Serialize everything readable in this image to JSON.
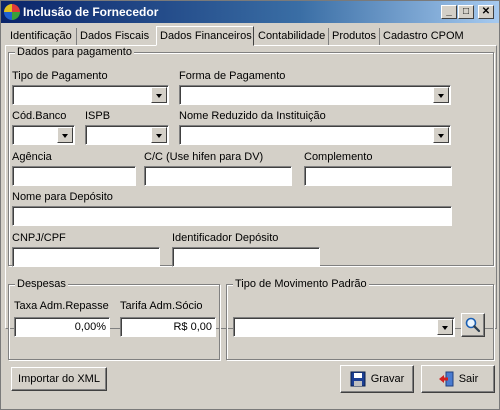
{
  "window": {
    "title": "Inclusão de Fornecedor",
    "minimize": "_",
    "maximize": "□",
    "close": "✕"
  },
  "tabs": [
    {
      "label": "Identificação"
    },
    {
      "label": "Dados Fiscais"
    },
    {
      "label": "Dados Financeiros",
      "active": true
    },
    {
      "label": "Contabilidade"
    },
    {
      "label": "Produtos"
    },
    {
      "label": "Cadastro CPOM"
    }
  ],
  "pagamento": {
    "legend": "Dados para pagamento",
    "tipo_pagamento": {
      "label": "Tipo de Pagamento",
      "value": ""
    },
    "forma_pagamento": {
      "label": "Forma de Pagamento",
      "value": ""
    },
    "cod_banco": {
      "label": "Cód.Banco",
      "value": ""
    },
    "ispb": {
      "label": "ISPB",
      "value": ""
    },
    "nome_reduzido": {
      "label": "Nome Reduzido da Instituição",
      "value": ""
    },
    "agencia": {
      "label": "Agência",
      "value": ""
    },
    "conta": {
      "label": "C/C (Use hifen para DV)",
      "value": ""
    },
    "complemento": {
      "label": "Complemento",
      "value": ""
    },
    "nome_deposito": {
      "label": "Nome para Depósito",
      "value": ""
    },
    "cnpj_cpf": {
      "label": "CNPJ/CPF",
      "value": ""
    },
    "identificador_deposito": {
      "label": "Identificador Depósito",
      "value": ""
    }
  },
  "despesas": {
    "legend": "Despesas",
    "taxa_adm": {
      "label": "Taxa Adm.Repasse",
      "value": "0,00%"
    },
    "tarifa_adm": {
      "label": "Tarifa Adm.Sócio",
      "value": "R$ 0,00"
    }
  },
  "movimento": {
    "legend": "Tipo de Movimento Padrão",
    "value": ""
  },
  "buttons": {
    "importar": "Importar do XML",
    "gravar": "Gravar",
    "sair": "Sair"
  },
  "icons": {
    "search": "magnifier-icon",
    "save": "floppy-disk-icon",
    "exit": "exit-door-icon"
  }
}
